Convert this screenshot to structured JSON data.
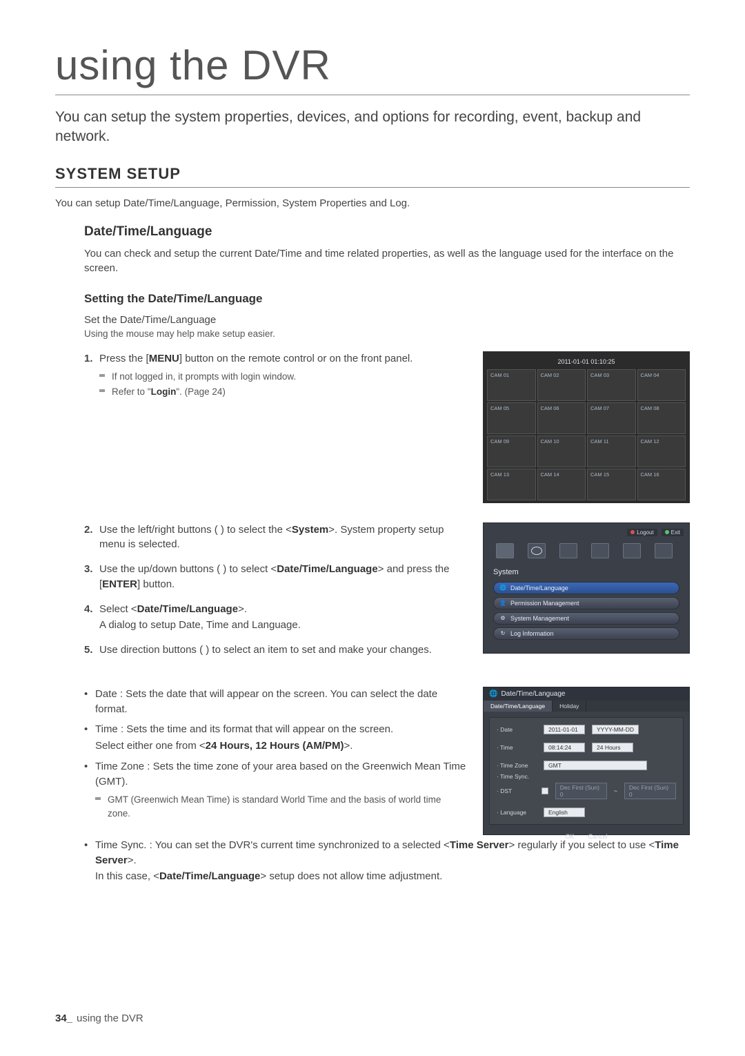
{
  "page": {
    "title": "using the DVR",
    "intro": "You can setup the system properties, devices, and options for recording, event, backup and network.",
    "footer": {
      "page_num": "34_",
      "label": "using the DVR"
    }
  },
  "system_setup": {
    "heading": "SYSTEM SETUP",
    "desc": "You can setup Date/Time/Language, Permission, System Properties and Log."
  },
  "dtl": {
    "heading": "Date/Time/Language",
    "desc": "You can check and setup the current Date/Time and time related properties, as well as the language used for the interface on the screen."
  },
  "setting": {
    "heading": "Setting the Date/Time/Language",
    "line1": "Set the Date/Time/Language",
    "line2": "Using the mouse may help make setup easier.",
    "steps": [
      {
        "num": "1.",
        "text_a": "Press the [",
        "bold_a": "MENU",
        "text_b": "] button on the remote control or on the front panel.",
        "sub_a": "If not logged in, it prompts with login window.",
        "sub_b_a": "Refer to \"",
        "sub_b_bold": "Login",
        "sub_b_b": "\". (Page 24)"
      },
      {
        "num": "2.",
        "text_a": "Use the left/right buttons (      ) to select the <",
        "bold_a": "System",
        "text_b": ">. System property setup menu is selected."
      },
      {
        "num": "3.",
        "text_a": "Use the up/down buttons (      ) to select <",
        "bold_a": "Date/Time/Language",
        "text_b": "> and press the [",
        "bold_b": "ENTER",
        "text_c": "] button."
      },
      {
        "num": "4.",
        "text_a": "Select <",
        "bold_a": "Date/Time/Language",
        "text_b": ">.",
        "tail": "A dialog to setup Date, Time and Language."
      },
      {
        "num": "5.",
        "text_a": "Use direction buttons (            ) to select an item to set and make your changes."
      }
    ],
    "bullets": [
      {
        "text": "Date : Sets the date that will appear on the screen. You can select the date format."
      },
      {
        "text": "Time : Sets the time and its format that will appear on the screen.",
        "tail_a": "Select either one from <",
        "tail_bold": "24 Hours, 12 Hours (AM/PM)",
        "tail_b": ">."
      },
      {
        "text": "Time Zone : Sets the time zone of your area based on the Greenwich Mean Time (GMT).",
        "sub": "GMT (Greenwich Mean Time) is standard World Time and the basis of world time zone."
      },
      {
        "text_a": "Time Sync. : You can set the DVR's current time synchronized to a selected <",
        "bold_a": "Time Server",
        "text_b": "> regularly if you select to use <",
        "bold_b": "Time Server",
        "text_c": ">.",
        "tail_a": "In this case, <",
        "tail_bold": "Date/Time/Language",
        "tail_b": "> setup does not allow time adjustment."
      }
    ]
  },
  "dvr_grid": {
    "timestamp": "2011-01-01 01:10:25",
    "cams": [
      "CAM 01",
      "CAM 02",
      "CAM 03",
      "CAM 04",
      "CAM 05",
      "CAM 06",
      "CAM 07",
      "CAM 08",
      "CAM 09",
      "CAM 10",
      "CAM 11",
      "CAM 12",
      "CAM 13",
      "CAM 14",
      "CAM 15",
      "CAM 16"
    ]
  },
  "sys_menu": {
    "logout": "Logout",
    "exit": "Exit",
    "heading": "System",
    "items": [
      {
        "icon": "🌐",
        "label": "Date/Time/Language"
      },
      {
        "icon": "👤",
        "label": "Permission Management"
      },
      {
        "icon": "⚙",
        "label": "System Management"
      },
      {
        "icon": "↻",
        "label": "Log Information"
      }
    ]
  },
  "dt_dialog": {
    "title": "Date/Time/Language",
    "tabs": {
      "active": "Date/Time/Language",
      "other": "Holiday"
    },
    "rows": {
      "date": {
        "label": "Date",
        "value": "2011-01-01",
        "format": "YYYY-MM-DD"
      },
      "time": {
        "label": "Time",
        "value": "08:14:24",
        "format": "24 Hours"
      },
      "tz": {
        "label": "Time Zone",
        "value": "GMT"
      },
      "sync": {
        "label": "Time Sync."
      },
      "dst": {
        "label": "DST",
        "from": "Dec First (Sun) 0",
        "to": "Dec First (Sun) 0"
      },
      "lang": {
        "label": "Language",
        "value": "English"
      }
    },
    "buttons": {
      "ok": "OK",
      "cancel": "Cancel"
    }
  }
}
